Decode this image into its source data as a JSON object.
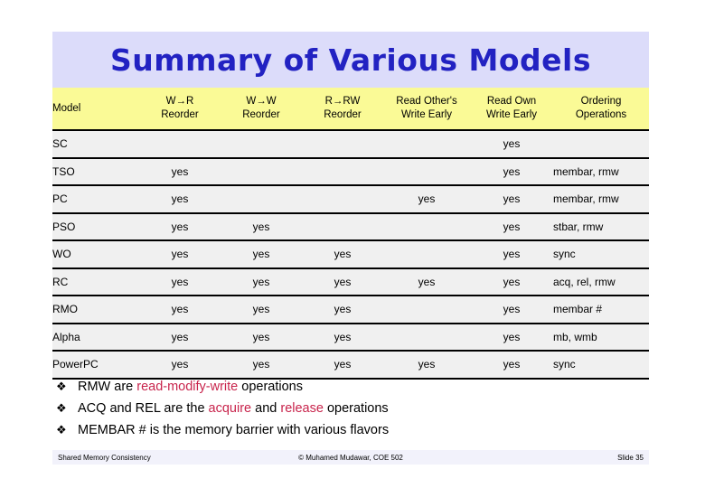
{
  "slide": {
    "title": "Summary of Various Models"
  },
  "table": {
    "columns": [
      {
        "line1": "",
        "line2": "Model"
      },
      {
        "line1": "W→R",
        "line2": "Reorder"
      },
      {
        "line1": "W→W",
        "line2": "Reorder"
      },
      {
        "line1": "R→RW",
        "line2": "Reorder"
      },
      {
        "line1": "Read Other's",
        "line2": "Write Early"
      },
      {
        "line1": "Read Own",
        "line2": "Write Early"
      },
      {
        "line1": "Ordering",
        "line2": "Operations"
      }
    ],
    "yes_label": "yes",
    "rows": [
      {
        "model": "SC",
        "wr": "",
        "ww": "",
        "rrw": "",
        "read_other": "",
        "read_own": "yes",
        "ops": ""
      },
      {
        "model": "TSO",
        "wr": "yes",
        "ww": "",
        "rrw": "",
        "read_other": "",
        "read_own": "yes",
        "ops": "membar, rmw"
      },
      {
        "model": "PC",
        "wr": "yes",
        "ww": "",
        "rrw": "",
        "read_other": "yes",
        "read_own": "yes",
        "ops": "membar, rmw"
      },
      {
        "model": "PSO",
        "wr": "yes",
        "ww": "yes",
        "rrw": "",
        "read_other": "",
        "read_own": "yes",
        "ops": "stbar, rmw"
      },
      {
        "model": "WO",
        "wr": "yes",
        "ww": "yes",
        "rrw": "yes",
        "read_other": "",
        "read_own": "yes",
        "ops": "sync"
      },
      {
        "model": "RC",
        "wr": "yes",
        "ww": "yes",
        "rrw": "yes",
        "read_other": "yes",
        "read_own": "yes",
        "ops": "acq, rel, rmw"
      },
      {
        "model": "RMO",
        "wr": "yes",
        "ww": "yes",
        "rrw": "yes",
        "read_other": "",
        "read_own": "yes",
        "ops": "membar #"
      },
      {
        "model": "Alpha",
        "wr": "yes",
        "ww": "yes",
        "rrw": "yes",
        "read_other": "",
        "read_own": "yes",
        "ops": "mb, wmb"
      },
      {
        "model": "PowerPC",
        "wr": "yes",
        "ww": "yes",
        "rrw": "yes",
        "read_other": "yes",
        "read_own": "yes",
        "ops": "sync"
      }
    ]
  },
  "bullets": {
    "marker": "❖",
    "items": [
      {
        "pre": "RMW are ",
        "hl1": "read-modify-write",
        "mid": " operations",
        "hl2": "",
        "post": ""
      },
      {
        "pre": "ACQ and REL are the ",
        "hl1": "acquire",
        "mid": " and ",
        "hl2": "release",
        "post": " operations"
      },
      {
        "pre": "MEMBAR # is the memory barrier with various flavors",
        "hl1": "",
        "mid": "",
        "hl2": "",
        "post": ""
      }
    ]
  },
  "footer": {
    "left": "Shared Memory Consistency",
    "center": "© Muhamed Mudawar, COE 502",
    "right": "Slide 35"
  },
  "colors": {
    "title_band": "#dcdcfa",
    "title_text": "#2222c2",
    "header_row": "#fafa96",
    "body_row": "#f0f0f0",
    "highlight": "#c8244c",
    "footer_band": "#f2f2fb"
  }
}
